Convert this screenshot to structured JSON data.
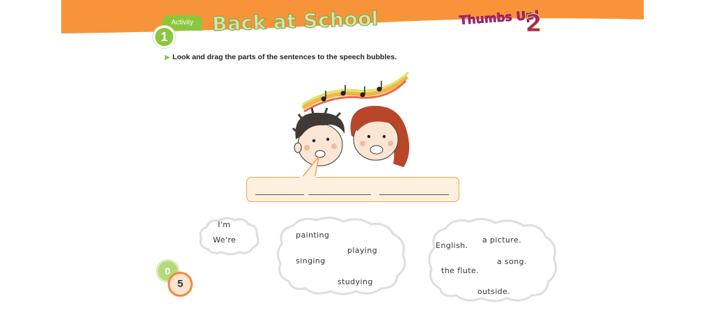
{
  "header": {
    "activity_label": "Activity",
    "activity_number": "1",
    "title": "Back at School",
    "logo_text": "Thumbs Up!",
    "logo_number": "2",
    "colors": {
      "banner": "#f7943a",
      "accent_green": "#8cc63f",
      "logo_purple": "#a4207a"
    }
  },
  "instruction": "Look and drag the parts of the sentences to the speech bubbles.",
  "clouds": {
    "subjects": [
      "I'm",
      "We're"
    ],
    "verbs": [
      "painting",
      "playing",
      "singing",
      "studying"
    ],
    "objects": [
      "English.",
      "a picture.",
      "a song.",
      "the flute.",
      "outside."
    ]
  },
  "progress": {
    "completed": "0",
    "total": "5"
  },
  "illustration": "boy-and-girl-singing"
}
